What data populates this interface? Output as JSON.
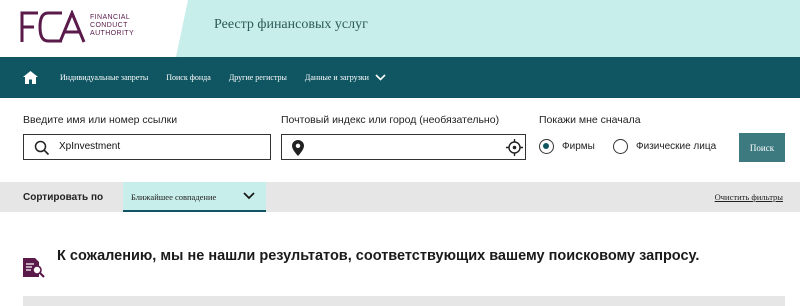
{
  "header": {
    "logo_letters": "FCA",
    "logo_lines": [
      "FINANCIAL",
      "CONDUCT",
      "AUTHORITY"
    ],
    "service_title": "Реестр финансовых услуг"
  },
  "nav": {
    "home_icon": "home-icon",
    "items": [
      {
        "label": "Индивидуальные запреты"
      },
      {
        "label": "Поиск фонда"
      },
      {
        "label": "Другие регистры"
      },
      {
        "label": "Данные и загрузки"
      }
    ]
  },
  "search": {
    "name_label": "Введите имя или номер ссылки",
    "name_value": "XpInvestment",
    "postcode_label": "Почтовый индекс или город (необязательно)",
    "postcode_value": "",
    "show_first_label": "Покажи мне сначала",
    "options": [
      {
        "label": "Фирмы",
        "selected": true
      },
      {
        "label": "Физические лица",
        "selected": false
      }
    ],
    "button_label": "Поиск"
  },
  "sort": {
    "label": "Сортировать по",
    "selected": "Ближайшее совпадение",
    "clear_label": "Очистить фильтры"
  },
  "result": {
    "message": "К сожалению, мы не нашли результатов, соответствующих вашему поисковому запросу."
  },
  "colors": {
    "nav_bg": "#0f5662",
    "header_accent": "#c7eeea",
    "brand": "#5a1a4a",
    "button_bg": "#3d7a80"
  }
}
